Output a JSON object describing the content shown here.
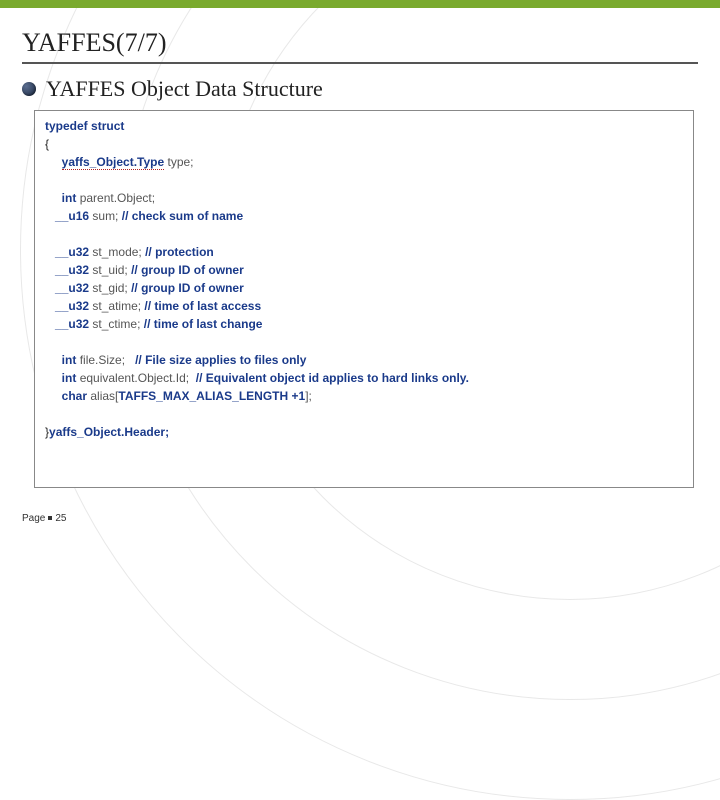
{
  "accent_color": "#7aaa2e",
  "slide": {
    "title": "YAFFES(7/7)",
    "heading": "YAFFES Object Data Structure"
  },
  "code": {
    "line01_kw1": "typedef",
    "line01_kw2": "struct",
    "line02": "{",
    "line03_type": "yaffs_Object.Type",
    "line03_var": "type;",
    "line05_kw": "int",
    "line05_var": "parent.Object;",
    "line06_type": "__u16",
    "line06_var": "sum;",
    "line06_cmt": "// check sum of name",
    "line08_type": "__u32",
    "line08_var": "st_mode;",
    "line08_cmt": "// protection",
    "line09_type": "__u32",
    "line09_var": "st_uid;",
    "line09_cmt": "// group ID of owner",
    "line10_type": "__u32",
    "line10_var": "st_gid;",
    "line10_cmt": "// group ID of owner",
    "line11_type": "__u32",
    "line11_var": "st_atime;",
    "line11_cmt": "// time of last access",
    "line12_type": "__u32",
    "line12_var": "st_ctime;",
    "line12_cmt": "// time of last change",
    "line14_kw": "int",
    "line14_var": "file.Size;",
    "line14_cmt": "// File size applies to files only",
    "line15_kw": "int",
    "line15_var": "equivalent.Object.Id;",
    "line15_cmt": "// Equivalent object id applies to hard links only.",
    "line16_kw": "char",
    "line16_var": "alias[",
    "line16_macro": "TAFFS_MAX_ALIAS_LENGTH +1",
    "line16_close": "];",
    "line18_close": "}",
    "line18_name": "yaffs_Object.Header;"
  },
  "footer": {
    "page_label": "Page",
    "page_number": "25"
  }
}
